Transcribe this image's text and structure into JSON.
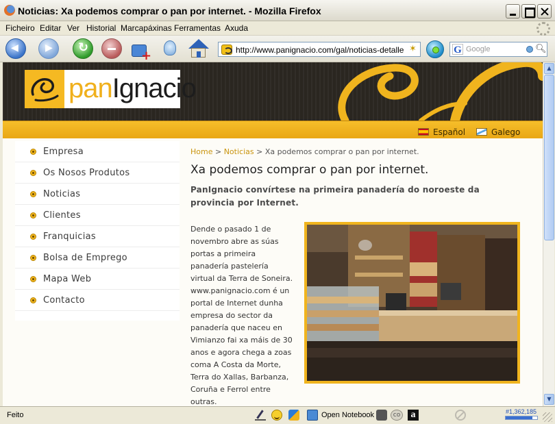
{
  "window": {
    "title": "Noticias: Xa podemos comprar o pan por internet. - Mozilla Firefox"
  },
  "menu": [
    "Ficheiro",
    "Editar",
    "Ver",
    "Historial",
    "Marcapáxinas",
    "Ferramentas",
    "Axuda"
  ],
  "toolbar": {
    "url": "http://www.panignacio.com/gal/noticias-detalles.as",
    "search_placeholder": "Google"
  },
  "site": {
    "logo": {
      "pan": "pan",
      "ignacio": "Ignacio"
    },
    "languages": [
      {
        "label": "Español",
        "flag": "es"
      },
      {
        "label": "Galego",
        "flag": "gl"
      }
    ],
    "nav": [
      "Empresa",
      "Os Nosos Produtos",
      "Noticias",
      "Clientes",
      "Franquicias",
      "Bolsa de Emprego",
      "Mapa Web",
      "Contacto"
    ],
    "breadcrumb": {
      "home": "Home",
      "sep1": ">",
      "section": "Noticias",
      "sep2": ">",
      "current": "Xa podemos comprar o pan por internet."
    },
    "article": {
      "title": "Xa podemos comprar o pan por internet.",
      "lead": "PanIgnacio convírtese na primeira panadería do noroeste da provincia por Internet.",
      "body": "Dende o pasado 1 de novembro abre as súas portas a primeira panadería pastelería virtual da Terra de Soneira. www.panignacio.com é un portal de Internet dunha empresa do sector da panadería que naceu en Vimianzo fai xa máis de 30 anos e agora chega a zoas coma A Costa da Morte, Terra do Xallas, Barbanza, Coruña e Ferrol entre outras."
    },
    "colors": {
      "accent": "#f0b41e",
      "header": "#2a2620",
      "link": "#c9940e"
    }
  },
  "status": {
    "text": "Feito",
    "notebook": "Open Notebook",
    "rank": "#1,362,185",
    "rank_fill": 0.85
  },
  "icons": [
    "firefox-icon",
    "back-icon",
    "forward-icon",
    "reload-icon",
    "stop-icon",
    "add-bookmark-icon",
    "bulb-icon",
    "home-icon",
    "feed-icon",
    "go-icon",
    "google-icon",
    "search-icon"
  ]
}
